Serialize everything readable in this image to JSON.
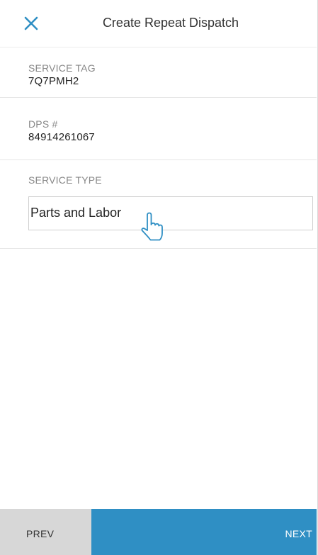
{
  "header": {
    "title": "Create Repeat Dispatch",
    "close_icon": "close-icon"
  },
  "fields": {
    "service_tag": {
      "label": "SERVICE TAG",
      "value": "7Q7PMH2"
    },
    "dps": {
      "label": "DPS #",
      "value": "84914261067"
    },
    "service_type": {
      "label": "SERVICE TYPE",
      "value": "Parts and Labor"
    }
  },
  "footer": {
    "prev_label": "PREV",
    "next_label": "NEXT"
  },
  "colors": {
    "accent": "#2f8fc4",
    "prev_background": "#d7d7d7",
    "label_gray": "#888888"
  },
  "cursor_icon": "pointing-hand-cursor-icon"
}
